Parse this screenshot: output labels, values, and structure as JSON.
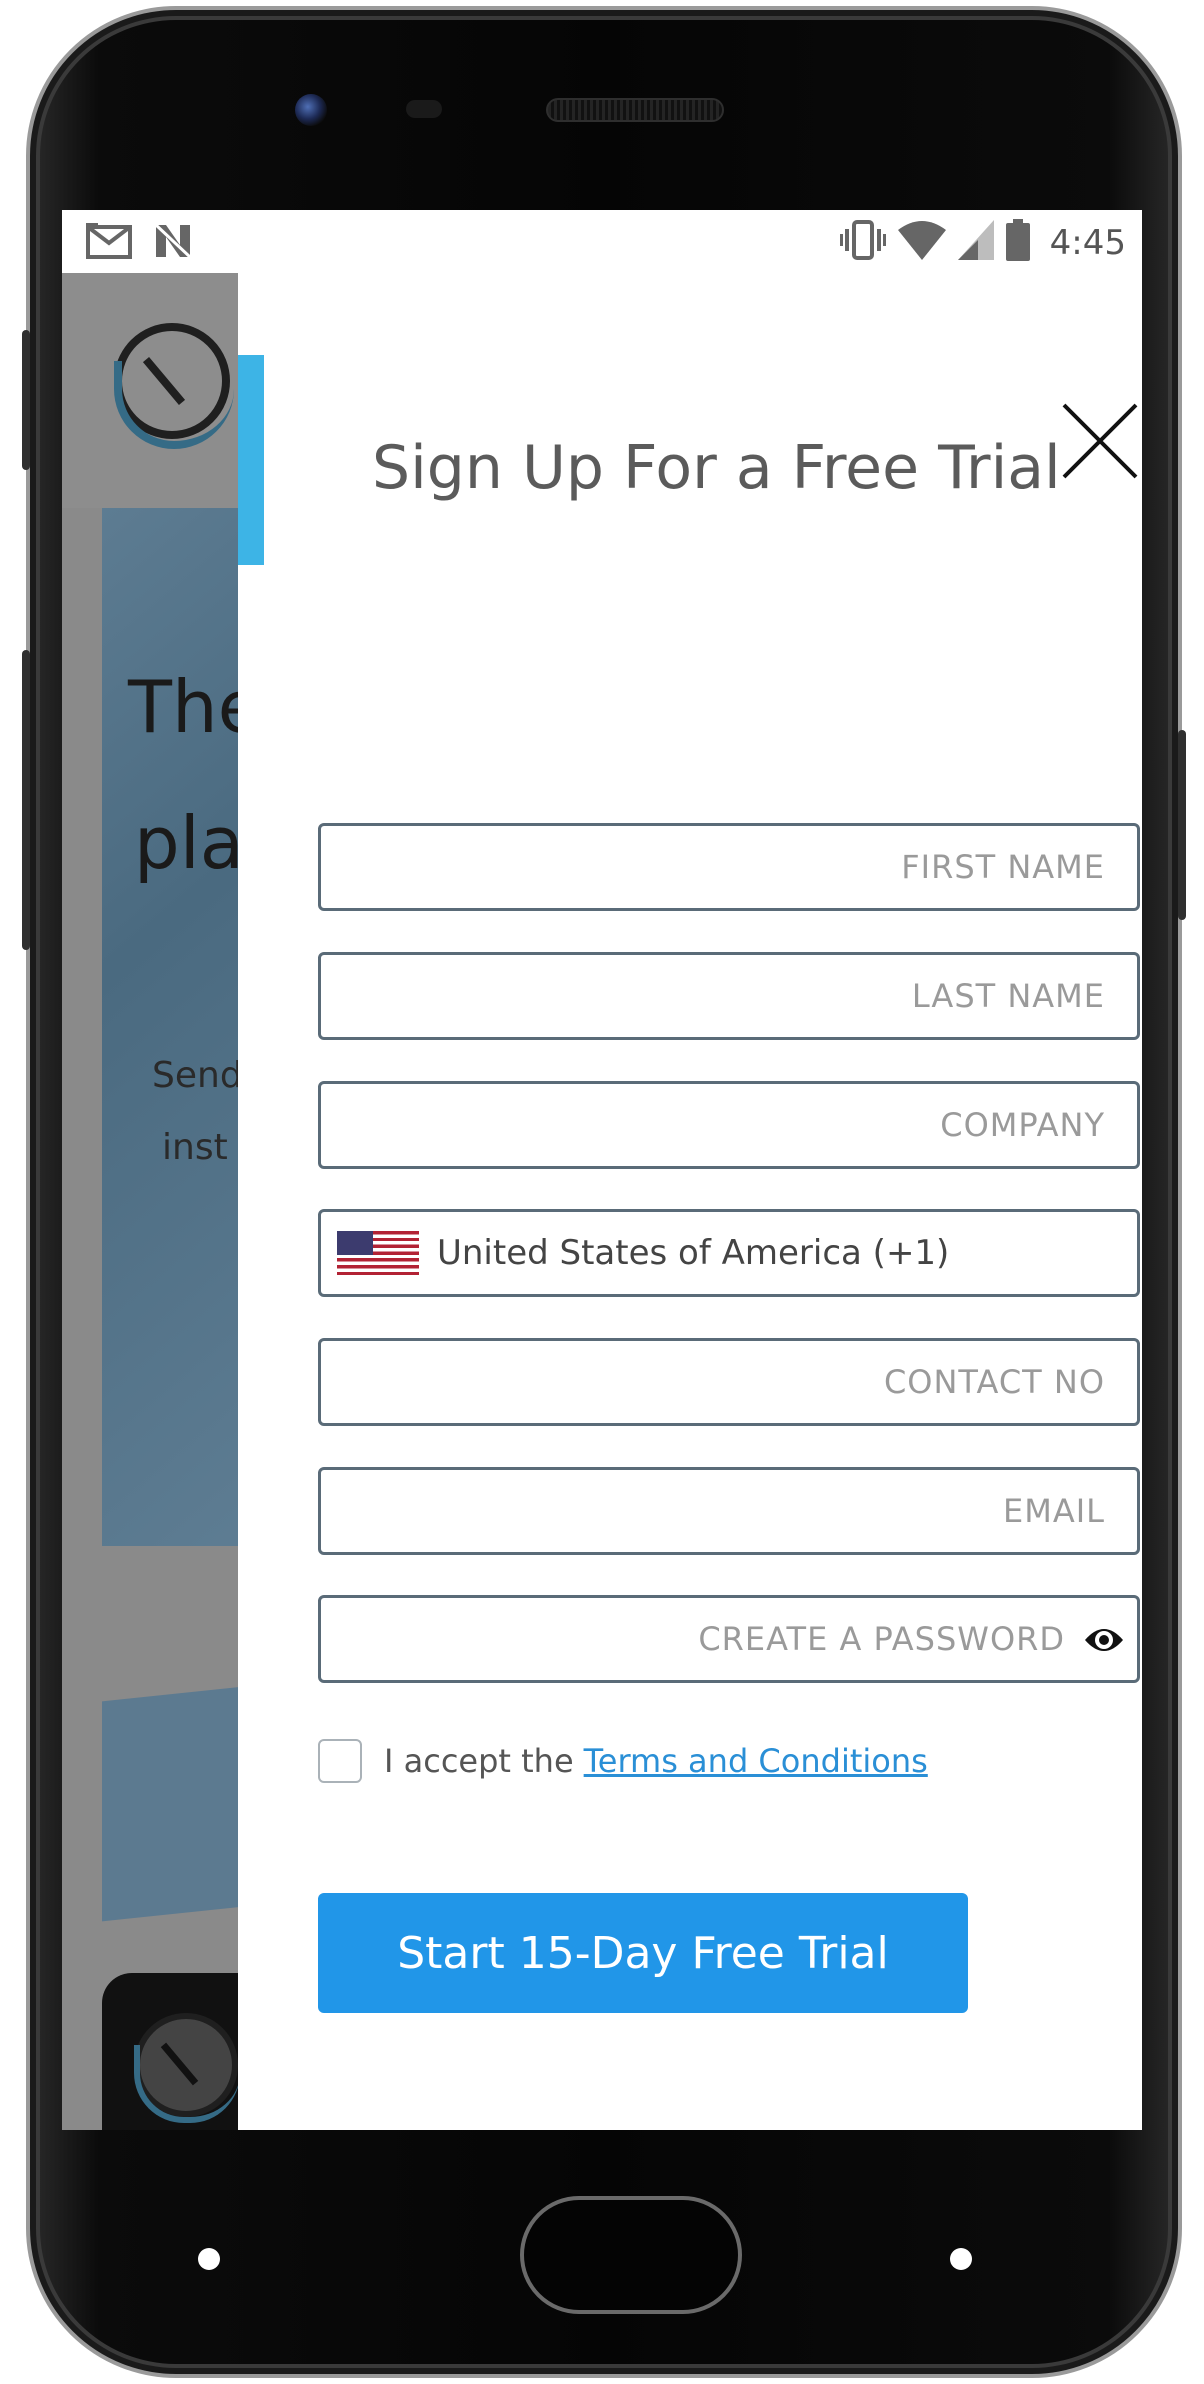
{
  "status_bar": {
    "time": "4:45",
    "left_icons": [
      "gmail-icon",
      "notification-n-icon"
    ],
    "right_icons": [
      "vibrate-icon",
      "wifi-icon",
      "signal-icon",
      "battery-icon"
    ]
  },
  "background_page": {
    "heading_line1": "The",
    "heading_line2": "pla",
    "body_line1": "Send",
    "body_line2": "inst"
  },
  "modal": {
    "title": "Sign Up For a Free Trial",
    "close_icon": "close-icon",
    "accent_color": "#3db4e6",
    "fields": {
      "first_name": {
        "placeholder": "FIRST NAME"
      },
      "last_name": {
        "placeholder": "LAST NAME"
      },
      "company": {
        "placeholder": "COMPANY"
      },
      "country": {
        "value": "United States of America (+1)",
        "flag": "us-flag-icon"
      },
      "contact_no": {
        "placeholder": "CONTACT NO"
      },
      "email": {
        "placeholder": "EMAIL"
      },
      "password": {
        "placeholder": "CREATE A PASSWORD",
        "toggle_icon": "eye-icon"
      }
    },
    "terms": {
      "prefix": "I accept the",
      "link": "Terms and Conditions",
      "checked": false
    },
    "cta": {
      "label": "Start 15-Day Free Trial",
      "color": "#2196e8"
    }
  }
}
